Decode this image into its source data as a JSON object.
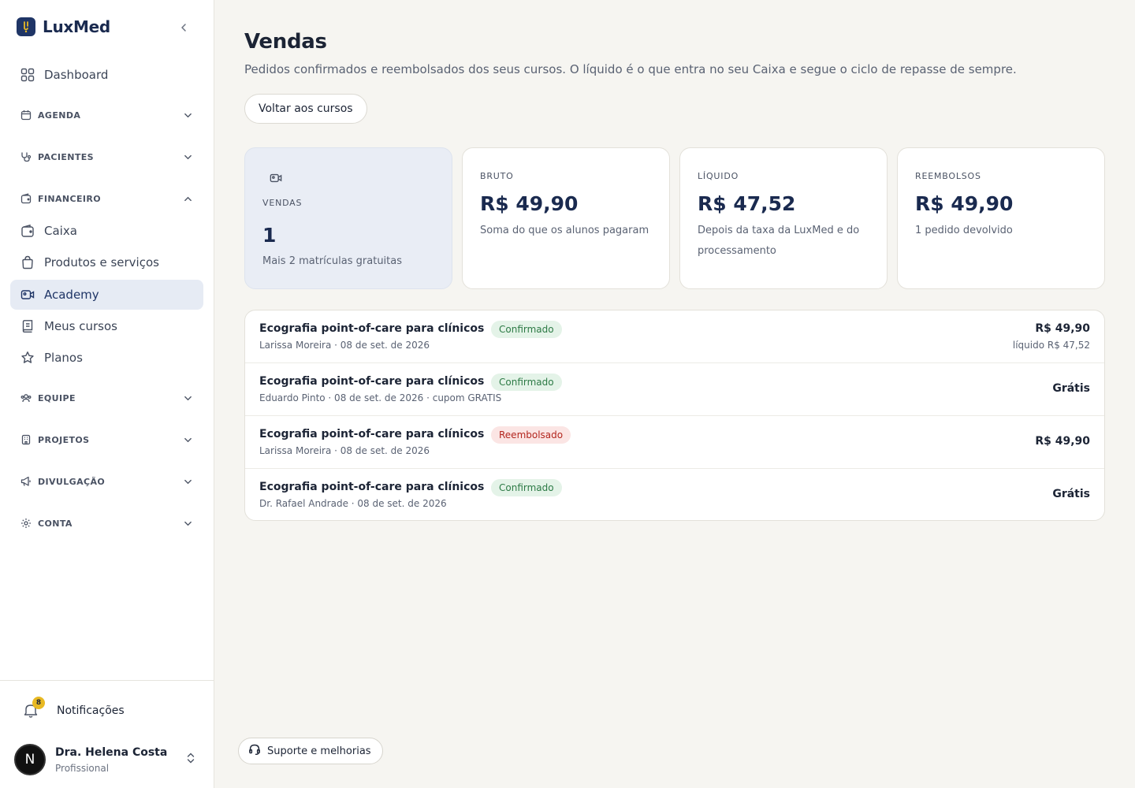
{
  "brand": {
    "name": "LuxMed"
  },
  "sidebar": {
    "dashboard": "Dashboard",
    "groups": {
      "agenda": "AGENDA",
      "pacientes": "PACIENTES",
      "financeiro": "FINANCEIRO",
      "equipe": "EQUIPE",
      "projetos": "PROJETOS",
      "divulgacao": "DIVULGAÇÃO",
      "conta": "CONTA"
    },
    "financeiro_items": {
      "caixa": "Caixa",
      "produtos": "Produtos e serviços",
      "academy": "Academy",
      "meus_cursos": "Meus cursos",
      "planos": "Planos"
    },
    "active_item": "Academy"
  },
  "footer": {
    "notifications_label": "Notificações",
    "notifications_count": "8",
    "user_initial": "N",
    "user_name": "Dra. Helena Costa",
    "user_role": "Profissional"
  },
  "main": {
    "title": "Vendas",
    "subtitle": "Pedidos confirmados e reembolsados dos seus cursos. O líquido é o que entra no seu Caixa e segue o ciclo de repasse de sempre.",
    "back_button": "Voltar aos cursos",
    "cards": {
      "vendas": {
        "label": "VENDAS",
        "value": "1",
        "desc": "Mais 2 matrículas gratuitas"
      },
      "bruto": {
        "label": "BRUTO",
        "value": "R$ 49,90",
        "desc": "Soma do que os alunos pagaram"
      },
      "liquido": {
        "label": "LÍQUIDO",
        "value": "R$ 47,52",
        "desc": "Depois da taxa da LuxMed e do processamento"
      },
      "reembolsos": {
        "label": "REEMBOLSOS",
        "value": "R$ 49,90",
        "desc": "1 pedido devolvido"
      }
    },
    "orders": [
      {
        "course": "Ecografia point-of-care para clínicos",
        "status": "Confirmado",
        "meta": "Larissa Moreira · 08 de set. de 2026",
        "amount": "R$ 49,90",
        "net": "líquido R$ 47,52"
      },
      {
        "course": "Ecografia point-of-care para clínicos",
        "status": "Confirmado",
        "meta": "Eduardo Pinto · 08 de set. de 2026 · cupom GRATIS",
        "amount": "Grátis"
      },
      {
        "course": "Ecografia point-of-care para clínicos",
        "status": "Reembolsado",
        "meta": "Larissa Moreira · 08 de set. de 2026",
        "amount": "R$ 49,90"
      },
      {
        "course": "Ecografia point-of-care para clínicos",
        "status": "Confirmado",
        "meta": "Dr. Rafael Andrade · 08 de set. de 2026",
        "amount": "Grátis"
      }
    ],
    "support_button": "Suporte e melhorias"
  },
  "colors": {
    "accent": "#1f3566",
    "active_bg": "#e6ebf4",
    "confirmed": "#2c7a45",
    "refunded": "#b3261e",
    "badge": "#e8b923"
  }
}
